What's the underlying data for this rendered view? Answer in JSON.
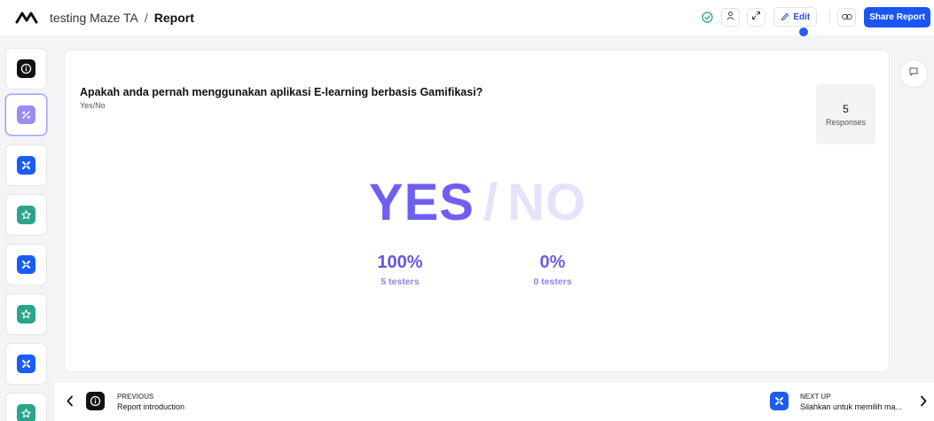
{
  "header": {
    "project": "testing Maze TA",
    "separator": "/",
    "page": "Report",
    "icons": [
      "maze-logo-icon",
      "saved-check-icon",
      "person-icon",
      "expand-icon",
      "link-icon"
    ],
    "edit_label": "Edit",
    "share_label": "Share Report"
  },
  "sidebar": {
    "blocks": [
      {
        "icon": "info-icon",
        "color": "#111111"
      },
      {
        "icon": "yes-no-icon",
        "color": "#9b8cf0",
        "active": true
      },
      {
        "icon": "mission-icon",
        "color": "#1a5cf5"
      },
      {
        "icon": "star-icon",
        "color": "#2aa58c"
      },
      {
        "icon": "mission-icon",
        "color": "#1a5cf5"
      },
      {
        "icon": "star-icon",
        "color": "#2aa58c"
      },
      {
        "icon": "mission-icon",
        "color": "#1a5cf5"
      },
      {
        "icon": "star-icon",
        "color": "#2aa58c"
      }
    ]
  },
  "main": {
    "question": "Apakah anda pernah menggunakan aplikasi E-learning berbasis Gamifikasi?",
    "type": "Yes/No",
    "responses_count": "5",
    "responses_label": "Responses",
    "yes_label": "YES",
    "slash": "/",
    "no_label": "NO",
    "yes_percent": "100%",
    "yes_testers": "5 testers",
    "no_percent": "0%",
    "no_testers": "0 testers",
    "accent_color": "#6e5ff0"
  },
  "footer": {
    "previous_kicker": "PREVIOUS",
    "previous_title": "Report introduction",
    "next_kicker": "NEXT UP",
    "next_title": "Silahkan untuk memilih ma..."
  }
}
